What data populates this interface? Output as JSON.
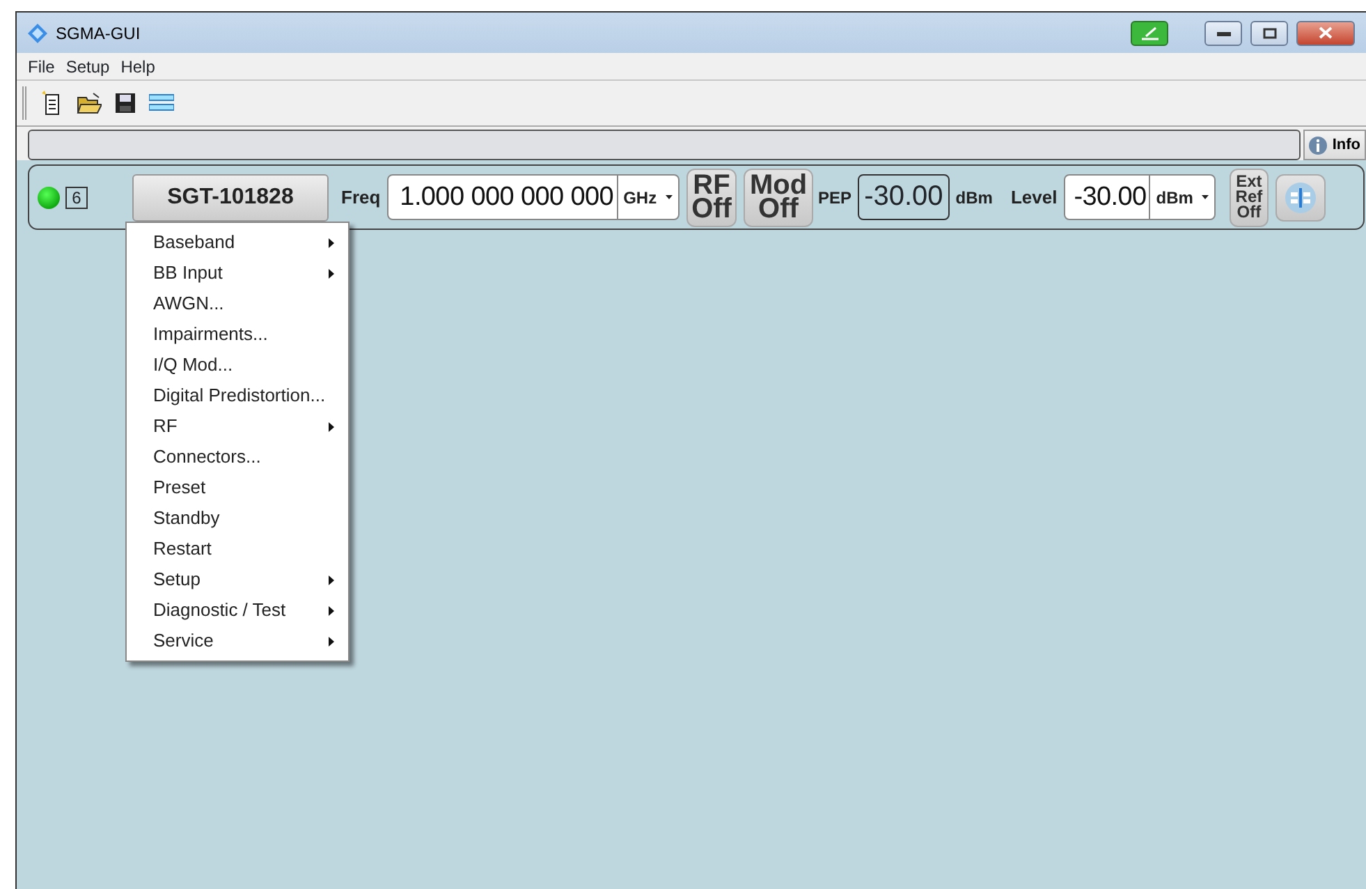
{
  "window": {
    "title": "SGMA-GUI"
  },
  "menu_bar": [
    "File",
    "Setup",
    "Help"
  ],
  "toolbar": [
    {
      "kind": "new"
    },
    {
      "kind": "open"
    },
    {
      "kind": "save"
    },
    {
      "kind": "layout"
    }
  ],
  "info_button": "Info",
  "instrument": {
    "connected": true,
    "count": "6",
    "name": "SGT-101828",
    "freq_label": "Freq",
    "freq_value": "1.000 000 000 000",
    "freq_unit": "GHz",
    "rf_button": [
      "RF",
      "Off"
    ],
    "mod_button": [
      "Mod",
      "Off"
    ],
    "pep_label": "PEP",
    "pep_value": "-30.00",
    "pep_unit": "dBm",
    "level_label": "Level",
    "level_value": "-30.00",
    "level_unit": "dBm",
    "ext_ref_button": [
      "Ext",
      "Ref",
      "Off"
    ]
  },
  "context_menu": [
    {
      "label": "Baseband",
      "submenu": true
    },
    {
      "label": "BB Input",
      "submenu": true
    },
    {
      "label": "AWGN...",
      "submenu": false
    },
    {
      "label": "Impairments...",
      "submenu": false
    },
    {
      "label": "I/Q Mod...",
      "submenu": false
    },
    {
      "label": "Digital Predistortion...",
      "submenu": false
    },
    {
      "label": "RF",
      "submenu": true
    },
    {
      "label": "Connectors...",
      "submenu": false
    },
    {
      "label": "Preset",
      "submenu": false
    },
    {
      "label": "Standby",
      "submenu": false
    },
    {
      "label": "Restart",
      "submenu": false
    },
    {
      "label": "Setup",
      "submenu": true
    },
    {
      "label": "Diagnostic / Test",
      "submenu": true
    },
    {
      "label": "Service",
      "submenu": true
    }
  ]
}
